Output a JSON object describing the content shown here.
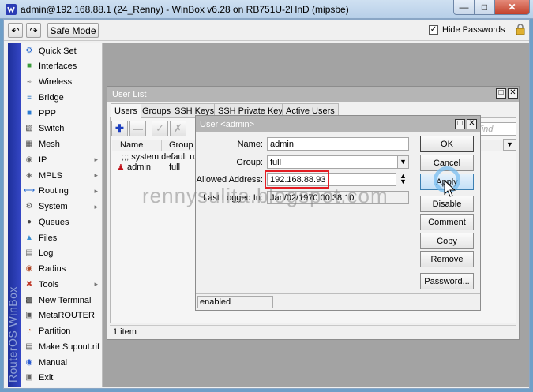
{
  "window": {
    "title": "admin@192.168.88.1 (24_Renny) - WinBox v6.28 on RB751U-2HnD (mipsbe)"
  },
  "toolbar": {
    "safe_mode": "Safe Mode",
    "hide_passwords": "Hide Passwords",
    "hide_passwords_checked": true
  },
  "sidebar": {
    "brand": "RouterOS WinBox",
    "items": [
      {
        "label": "Quick Set",
        "icon": "quickset-icon",
        "submenu": false
      },
      {
        "label": "Interfaces",
        "icon": "interfaces-icon",
        "submenu": false
      },
      {
        "label": "Wireless",
        "icon": "wireless-icon",
        "submenu": false
      },
      {
        "label": "Bridge",
        "icon": "bridge-icon",
        "submenu": false
      },
      {
        "label": "PPP",
        "icon": "ppp-icon",
        "submenu": false
      },
      {
        "label": "Switch",
        "icon": "switch-icon",
        "submenu": false
      },
      {
        "label": "Mesh",
        "icon": "mesh-icon",
        "submenu": false
      },
      {
        "label": "IP",
        "icon": "ip-icon",
        "submenu": true
      },
      {
        "label": "MPLS",
        "icon": "mpls-icon",
        "submenu": true
      },
      {
        "label": "Routing",
        "icon": "routing-icon",
        "submenu": true
      },
      {
        "label": "System",
        "icon": "system-icon",
        "submenu": true
      },
      {
        "label": "Queues",
        "icon": "queues-icon",
        "submenu": false
      },
      {
        "label": "Files",
        "icon": "files-icon",
        "submenu": false
      },
      {
        "label": "Log",
        "icon": "log-icon",
        "submenu": false
      },
      {
        "label": "Radius",
        "icon": "radius-icon",
        "submenu": false
      },
      {
        "label": "Tools",
        "icon": "tools-icon",
        "submenu": true
      },
      {
        "label": "New Terminal",
        "icon": "terminal-icon",
        "submenu": false
      },
      {
        "label": "MetaROUTER",
        "icon": "metarouter-icon",
        "submenu": false
      },
      {
        "label": "Partition",
        "icon": "partition-icon",
        "submenu": false
      },
      {
        "label": "Make Supout.rif",
        "icon": "supout-icon",
        "submenu": false
      },
      {
        "label": "Manual",
        "icon": "manual-icon",
        "submenu": false
      },
      {
        "label": "Exit",
        "icon": "exit-icon",
        "submenu": false
      }
    ]
  },
  "user_list": {
    "title": "User List",
    "tabs": [
      "Users",
      "Groups",
      "SSH Keys",
      "SSH Private Keys",
      "Active Users"
    ],
    "active_tab": "Users",
    "find_placeholder": "Find",
    "columns": [
      "Name",
      "Group"
    ],
    "rows": [
      {
        "name": ";;; system default user",
        "group": "",
        "comment": true
      },
      {
        "name": "admin",
        "group": "full",
        "comment": false
      }
    ],
    "status": "1 item"
  },
  "dialog": {
    "title": "User <admin>",
    "fields": {
      "name_label": "Name:",
      "name_value": "admin",
      "group_label": "Group:",
      "group_value": "full",
      "address_label": "Allowed Address:",
      "address_value": "192.168.88.93",
      "last_login_label": "Last Logged In:",
      "last_login_value": "Jan/02/1970 00:38:10"
    },
    "buttons": [
      "OK",
      "Cancel",
      "Apply",
      "Disable",
      "Comment",
      "Copy",
      "Remove",
      "Password..."
    ],
    "status": "enabled"
  },
  "watermark": "rennysulita.blogspot.com",
  "colors": {
    "brand_bar": "#2a3cb4",
    "highlight": "#e31d23",
    "close_button": "#c2412b"
  }
}
